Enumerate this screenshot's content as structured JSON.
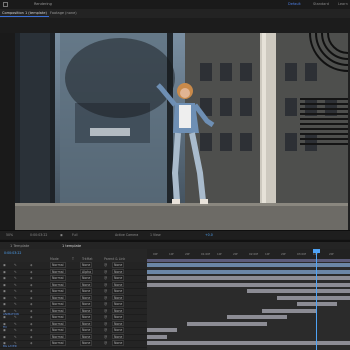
{
  "app": {
    "workspaces": [
      "Default",
      "Standard",
      "Learn"
    ],
    "active_workspace": "Default"
  },
  "tabs": {
    "comp_tab": "Composition 1 (template)",
    "footage_tab": "Footage (none)",
    "header_small": "Rendering"
  },
  "viewer": {
    "zoom": "50%",
    "timecode": "0:00:03:22",
    "quality": "Full",
    "camera": "Active Camera",
    "views": "1 View",
    "plus": "+0.0"
  },
  "timeline": {
    "tab1": "1 Template",
    "tab2": "1 template",
    "timecode": "0:00:03:22",
    "col_mode": "Mode",
    "col_t": "T",
    "col_trkmat": "TrkMat",
    "col_parent": "Parent & Link",
    "layers": [
      {
        "mode": "Normal",
        "trk": "None",
        "parent": "None"
      },
      {
        "mode": "Normal",
        "trk": "Alpha",
        "parent": "None"
      },
      {
        "mode": "Normal",
        "trk": "None",
        "parent": "None"
      },
      {
        "mode": "Normal",
        "trk": "None",
        "parent": "None"
      },
      {
        "mode": "Normal",
        "trk": "None",
        "parent": "None"
      },
      {
        "mode": "Normal",
        "trk": "None",
        "parent": "None"
      },
      {
        "mode": "Normal",
        "trk": "None",
        "parent": "None"
      },
      {
        "mode": "Normal",
        "trk": "None",
        "parent": "None"
      },
      {
        "mode": "Normal",
        "trk": "None",
        "parent": "None"
      },
      {
        "mode": "Normal",
        "trk": "None",
        "parent": "None"
      },
      {
        "mode": "Normal",
        "trk": "None",
        "parent": "None"
      },
      {
        "mode": "Normal",
        "trk": "None",
        "parent": "None"
      },
      {
        "mode": "Normal",
        "trk": "None",
        "parent": "None"
      }
    ],
    "special_rows": [
      "ANIMATION",
      "Fill",
      "BG LAYER"
    ],
    "ruler": [
      "00f",
      "10f",
      "20f",
      "01:00f",
      "10f",
      "20f",
      "02:00f",
      "10f",
      "20f",
      "03:00f",
      "10f",
      "20f"
    ]
  },
  "colors": {
    "accent": "#3a6fd8",
    "playhead": "#4fa3f5",
    "track_bar": "#8c8c94",
    "bg": "#1b1b1b"
  }
}
